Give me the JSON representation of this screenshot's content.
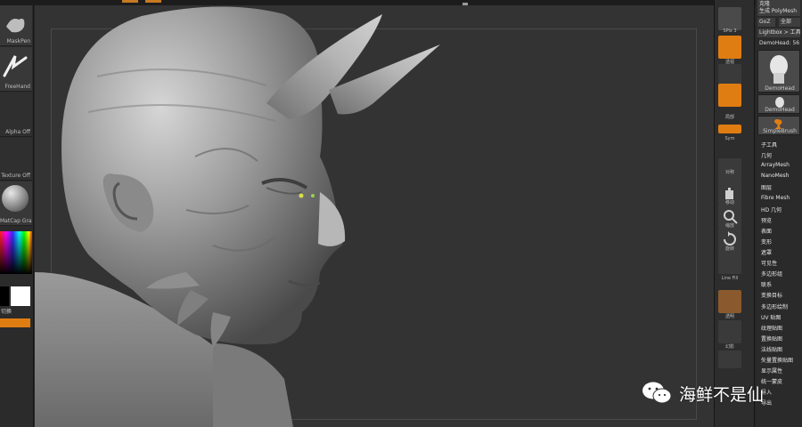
{
  "left_shelf": {
    "slots": [
      {
        "label": "MaskPen"
      },
      {
        "label": "FreeHand"
      },
      {
        "label": "Alpha Off"
      },
      {
        "label": "Texture Off"
      },
      {
        "label": "MatCap Gray"
      }
    ],
    "swap_label": "切换"
  },
  "right_shelf": {
    "labels": [
      "SPix 3",
      "透视",
      "地面",
      "局部",
      "Sym",
      "对称",
      "移动",
      "缩放",
      "旋转",
      "Line Fill",
      "透明",
      "幻影"
    ]
  },
  "right_panel": {
    "top_buttons": [
      "克隆",
      "生成 PolyMesh",
      "GoZ",
      "全部",
      "Lightbox > 工具",
      "DemoHead: 56"
    ],
    "thumbs": [
      {
        "caption": "DemoHead"
      },
      {
        "caption": "DemoHead"
      },
      {
        "caption": "SimpleBrush"
      }
    ],
    "menu": [
      "子工具",
      "几何",
      "ArrayMesh",
      "NanoMesh",
      "图层",
      "Fibre Mesh",
      "HD 几何",
      "预览",
      "表面",
      "变形",
      "遮罩",
      "可见性",
      "多边形组",
      "联系",
      "变换目标",
      "多边形绘制",
      "UV 贴图",
      "纹理贴图",
      "置换贴图",
      "法线贴图",
      "矢量置换贴图",
      "显示属性",
      "统一蒙皮",
      "导入",
      "导出"
    ]
  },
  "watermark": {
    "text": "海鲜不是仙"
  },
  "colors": {
    "accent": "#e07d12",
    "viewport": "#333333",
    "panel": "#2a2a2a"
  }
}
